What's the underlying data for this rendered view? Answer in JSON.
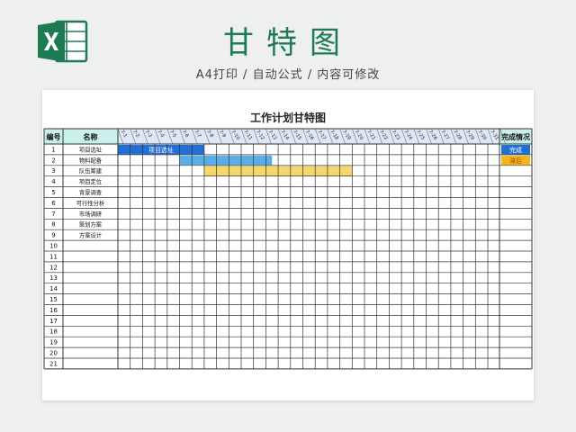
{
  "header": {
    "title": "甘特图",
    "subtitle": "A4打印 / 自动公式 / 内容可修改"
  },
  "sheet": {
    "title": "工作计划甘特图",
    "col_no": "编号",
    "col_name": "名称",
    "col_status": "完成情况",
    "dates": [
      "7-1",
      "7-2",
      "7-3",
      "7-4",
      "7-5",
      "7-6",
      "7-7",
      "7-8",
      "7-9",
      "7-10",
      "7-11",
      "7-12",
      "7-13",
      "7-14",
      "7-15",
      "7-16",
      "7-17",
      "7-18",
      "7-19",
      "7-20",
      "7-21",
      "7-22",
      "7-23",
      "7-24",
      "7-25",
      "7-26",
      "7-27",
      "7-28",
      "7-29",
      "7-30",
      "7-31"
    ],
    "rows": [
      {
        "no": "1",
        "name": "项目选址",
        "bar": {
          "start": 0,
          "end": 7,
          "color": "#1f6fd6",
          "label": "项目选址"
        },
        "status": "完成",
        "status_color": "#1f6fd6"
      },
      {
        "no": "2",
        "name": "物料配备",
        "bar": {
          "start": 5,
          "end": 12.5,
          "color": "#5aaee8",
          "label": ""
        },
        "status": "滞后",
        "status_color": "#f2b51c"
      },
      {
        "no": "3",
        "name": "队伍筹建",
        "bar": {
          "start": 7,
          "end": 19,
          "color": "#f5d76e",
          "label": ""
        },
        "status": "",
        "status_color": ""
      },
      {
        "no": "4",
        "name": "项目定位"
      },
      {
        "no": "5",
        "name": "背景调查"
      },
      {
        "no": "6",
        "name": "可行性分析"
      },
      {
        "no": "7",
        "name": "市场调研"
      },
      {
        "no": "8",
        "name": "策划方案"
      },
      {
        "no": "9",
        "name": "方案设计"
      },
      {
        "no": "10",
        "name": ""
      },
      {
        "no": "11",
        "name": ""
      },
      {
        "no": "12",
        "name": ""
      },
      {
        "no": "13",
        "name": ""
      },
      {
        "no": "14",
        "name": ""
      },
      {
        "no": "15",
        "name": ""
      },
      {
        "no": "16",
        "name": ""
      },
      {
        "no": "17",
        "name": ""
      },
      {
        "no": "18",
        "name": ""
      },
      {
        "no": "19",
        "name": ""
      },
      {
        "no": "20",
        "name": ""
      },
      {
        "no": "21",
        "name": ""
      }
    ],
    "colors": {
      "header_fill": "#c9f0ea",
      "date_fill": "#dfe6f5",
      "grid_line": "#333333"
    }
  }
}
